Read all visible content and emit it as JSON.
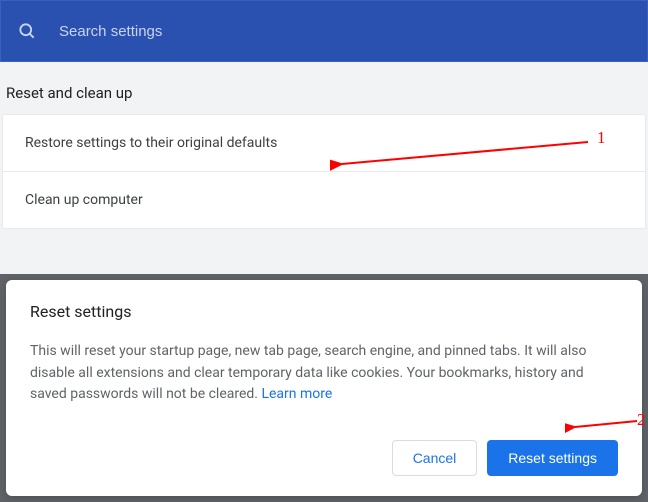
{
  "search": {
    "placeholder": "Search settings"
  },
  "section": {
    "title": "Reset and clean up",
    "rows": [
      {
        "label": "Restore settings to their original defaults"
      },
      {
        "label": "Clean up computer"
      }
    ]
  },
  "dialog": {
    "title": "Reset settings",
    "body_text": "This will reset your startup page, new tab page, search engine, and pinned tabs. It will also disable all extensions and clear temporary data like cookies. Your bookmarks, history and saved passwords will not be cleared. ",
    "learn_more": "Learn more",
    "cancel_label": "Cancel",
    "confirm_label": "Reset settings"
  },
  "annotations": {
    "a1": "1",
    "a2": "2"
  }
}
